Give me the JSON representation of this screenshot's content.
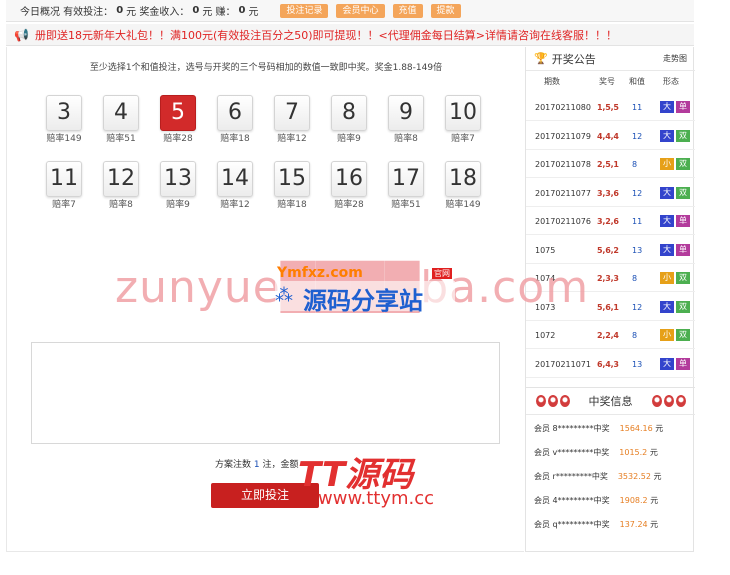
{
  "topbar": {
    "overview_label": "今日概况 有效投注：",
    "bet_amount": "0",
    "unit1": "元 奖金收入：",
    "income": "0",
    "unit2": "元 赚：",
    "profit": "0",
    "unit3": "元",
    "buttons": [
      "投注记录",
      "会员中心",
      "充值",
      "提款"
    ]
  },
  "marquee": {
    "icon": "megaphone-icon",
    "text": "册即送18元新年大礼包！！满100元(有效投注百分之50)即可提现！！<代理佣金每日结算>详情请咨询在线客服！！！"
  },
  "play": {
    "hint": "至少选择1个和值投注，选号与开奖的三个号码相加的数值一致即中奖。奖金1.88-149倍",
    "balls": [
      {
        "num": "3",
        "odds": "赔率149"
      },
      {
        "num": "4",
        "odds": "赔率51"
      },
      {
        "num": "5",
        "odds": "赔率28"
      },
      {
        "num": "6",
        "odds": "赔率18"
      },
      {
        "num": "7",
        "odds": "赔率12"
      },
      {
        "num": "8",
        "odds": "赔率9"
      },
      {
        "num": "9",
        "odds": "赔率8"
      },
      {
        "num": "10",
        "odds": "赔率7"
      },
      {
        "num": "11",
        "odds": "赔率7"
      },
      {
        "num": "12",
        "odds": "赔率8"
      },
      {
        "num": "13",
        "odds": "赔率9"
      },
      {
        "num": "14",
        "odds": "赔率12"
      },
      {
        "num": "15",
        "odds": "赔率18"
      },
      {
        "num": "16",
        "odds": "赔率28"
      },
      {
        "num": "17",
        "odds": "赔率51"
      },
      {
        "num": "18",
        "odds": "赔率149"
      }
    ],
    "selected": "5",
    "summary_prefix": "方案注数",
    "summary_count": "1",
    "summary_mid": "注，金额",
    "submit_label": "立即投注"
  },
  "results": {
    "title": "开奖公告",
    "trend_label": "走势图",
    "columns": [
      "期数",
      "奖号",
      "和值",
      "形态"
    ],
    "rows": [
      {
        "period": "20170211080",
        "nums": "1,5,5",
        "sum": "11",
        "size": "大",
        "parity": "单"
      },
      {
        "period": "20170211079",
        "nums": "4,4,4",
        "sum": "12",
        "size": "大",
        "parity": "双"
      },
      {
        "period": "20170211078",
        "nums": "2,5,1",
        "sum": "8",
        "size": "小",
        "parity": "双"
      },
      {
        "period": "20170211077",
        "nums": "3,3,6",
        "sum": "12",
        "size": "大",
        "parity": "双"
      },
      {
        "period": "20170211076",
        "nums": "3,2,6",
        "sum": "11",
        "size": "大",
        "parity": "单"
      },
      {
        "period": "1075",
        "nums": "5,6,2",
        "sum": "13",
        "size": "大",
        "parity": "单"
      },
      {
        "period": "1074",
        "nums": "2,3,3",
        "sum": "8",
        "size": "小",
        "parity": "双"
      },
      {
        "period": "1073",
        "nums": "5,6,1",
        "sum": "12",
        "size": "大",
        "parity": "双"
      },
      {
        "period": "1072",
        "nums": "2,2,4",
        "sum": "8",
        "size": "小",
        "parity": "双"
      },
      {
        "period": "20170211071",
        "nums": "6,4,3",
        "sum": "13",
        "size": "大",
        "parity": "单"
      }
    ]
  },
  "winners": {
    "title": "中奖信息",
    "rows": [
      {
        "prefix": "会员",
        "user": "8*********中奖",
        "amount": "1564.16",
        "unit": "元"
      },
      {
        "prefix": "会员",
        "user": "v*********中奖",
        "amount": "1015.2",
        "unit": "元"
      },
      {
        "prefix": "会员",
        "user": "r*********中奖",
        "amount": "3532.52",
        "unit": "元"
      },
      {
        "prefix": "会员",
        "user": "4*********中奖",
        "amount": "1908.2",
        "unit": "元"
      },
      {
        "prefix": "会员",
        "user": "q*********中奖",
        "amount": "137.24",
        "unit": "元"
      }
    ]
  },
  "watermarks": {
    "w1": "zunyue████ba.com",
    "w2": "Ymfxz.com",
    "w2_badge": "官网",
    "w3": "源码分享站",
    "w4": "TT源码",
    "w5": "www.ttym.cc"
  },
  "colors": {
    "accent": "#c8201f",
    "button_orange": "#f4a55a",
    "link_blue": "#1a4fb5"
  }
}
